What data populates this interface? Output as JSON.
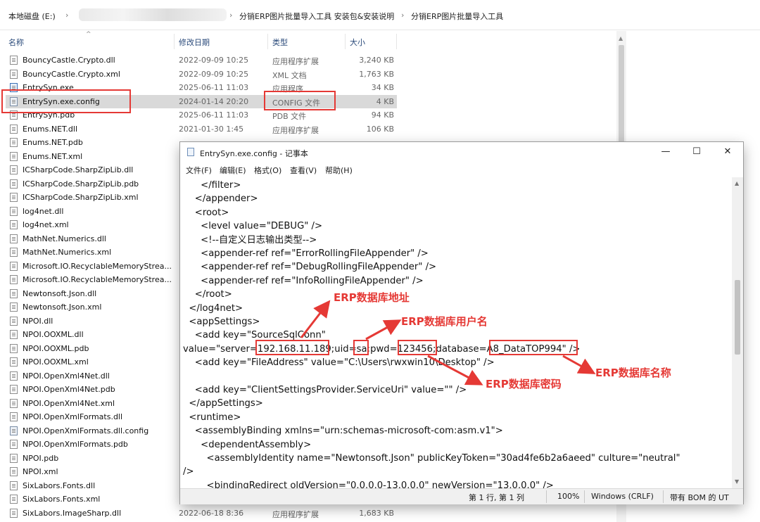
{
  "breadcrumb": {
    "root": "本地磁盘 (E:)",
    "sep": "›",
    "folder1": "分销ERP图片批量导入工具 安装包&安装说明",
    "folder2": "分销ERP图片批量导入工具"
  },
  "columns": {
    "name": "名称",
    "date": "修改日期",
    "type": "类型",
    "size": "大小"
  },
  "files": [
    {
      "name": "BouncyCastle.Crypto.dll",
      "date": "2022-09-09 10:25",
      "type": "应用程序扩展",
      "size": "3,240 KB",
      "icon": "dll-file-icon"
    },
    {
      "name": "BouncyCastle.Crypto.xml",
      "date": "2022-09-09 10:25",
      "type": "XML 文档",
      "size": "1,763 KB",
      "icon": "xml-file-icon"
    },
    {
      "name": "EntrySyn.exe",
      "date": "2025-06-11 11:03",
      "type": "应用程序",
      "size": "34 KB",
      "icon": "exe-file-icon"
    },
    {
      "name": "EntrySyn.exe.config",
      "date": "2024-01-14 20:20",
      "type": "CONFIG 文件",
      "size": "4 KB",
      "icon": "config-file-icon",
      "selected": true
    },
    {
      "name": "EntrySyn.pdb",
      "date": "2025-06-11 11:03",
      "type": "PDB 文件",
      "size": "94 KB",
      "icon": "pdb-file-icon"
    },
    {
      "name": "Enums.NET.dll",
      "date": "2021-01-30 1:45",
      "type": "应用程序扩展",
      "size": "106 KB",
      "icon": "dll-file-icon"
    },
    {
      "name": "Enums.NET.pdb",
      "date": "",
      "type": "",
      "size": "",
      "icon": "pdb-file-icon"
    },
    {
      "name": "Enums.NET.xml",
      "date": "",
      "type": "",
      "size": "",
      "icon": "xml-file-icon"
    },
    {
      "name": "ICSharpCode.SharpZipLib.dll",
      "date": "",
      "type": "",
      "size": "",
      "icon": "dll-file-icon"
    },
    {
      "name": "ICSharpCode.SharpZipLib.pdb",
      "date": "",
      "type": "",
      "size": "",
      "icon": "pdb-file-icon"
    },
    {
      "name": "ICSharpCode.SharpZipLib.xml",
      "date": "",
      "type": "",
      "size": "",
      "icon": "xml-file-icon"
    },
    {
      "name": "log4net.dll",
      "date": "",
      "type": "",
      "size": "",
      "icon": "dll-file-icon"
    },
    {
      "name": "log4net.xml",
      "date": "",
      "type": "",
      "size": "",
      "icon": "xml-file-icon"
    },
    {
      "name": "MathNet.Numerics.dll",
      "date": "",
      "type": "",
      "size": "",
      "icon": "dll-file-icon"
    },
    {
      "name": "MathNet.Numerics.xml",
      "date": "",
      "type": "",
      "size": "",
      "icon": "xml-file-icon"
    },
    {
      "name": "Microsoft.IO.RecyclableMemoryStrea...",
      "date": "",
      "type": "",
      "size": "",
      "icon": "dll-file-icon"
    },
    {
      "name": "Microsoft.IO.RecyclableMemoryStrea...",
      "date": "",
      "type": "",
      "size": "",
      "icon": "xml-file-icon"
    },
    {
      "name": "Newtonsoft.Json.dll",
      "date": "",
      "type": "",
      "size": "",
      "icon": "dll-file-icon"
    },
    {
      "name": "Newtonsoft.Json.xml",
      "date": "",
      "type": "",
      "size": "",
      "icon": "xml-file-icon"
    },
    {
      "name": "NPOI.dll",
      "date": "",
      "type": "",
      "size": "",
      "icon": "dll-file-icon"
    },
    {
      "name": "NPOI.OOXML.dll",
      "date": "",
      "type": "",
      "size": "",
      "icon": "dll-file-icon"
    },
    {
      "name": "NPOI.OOXML.pdb",
      "date": "",
      "type": "",
      "size": "",
      "icon": "pdb-file-icon"
    },
    {
      "name": "NPOI.OOXML.xml",
      "date": "",
      "type": "",
      "size": "",
      "icon": "xml-file-icon"
    },
    {
      "name": "NPOI.OpenXml4Net.dll",
      "date": "",
      "type": "",
      "size": "",
      "icon": "dll-file-icon"
    },
    {
      "name": "NPOI.OpenXml4Net.pdb",
      "date": "",
      "type": "",
      "size": "",
      "icon": "pdb-file-icon"
    },
    {
      "name": "NPOI.OpenXml4Net.xml",
      "date": "",
      "type": "",
      "size": "",
      "icon": "xml-file-icon"
    },
    {
      "name": "NPOI.OpenXmlFormats.dll",
      "date": "",
      "type": "",
      "size": "",
      "icon": "dll-file-icon"
    },
    {
      "name": "NPOI.OpenXmlFormats.dll.config",
      "date": "",
      "type": "",
      "size": "",
      "icon": "config-file-icon"
    },
    {
      "name": "NPOI.OpenXmlFormats.pdb",
      "date": "",
      "type": "",
      "size": "",
      "icon": "pdb-file-icon"
    },
    {
      "name": "NPOI.pdb",
      "date": "",
      "type": "",
      "size": "",
      "icon": "pdb-file-icon"
    },
    {
      "name": "NPOI.xml",
      "date": "",
      "type": "",
      "size": "",
      "icon": "xml-file-icon"
    },
    {
      "name": "SixLabors.Fonts.dll",
      "date": "",
      "type": "",
      "size": "",
      "icon": "dll-file-icon"
    },
    {
      "name": "SixLabors.Fonts.xml",
      "date": "",
      "type": "",
      "size": "",
      "icon": "xml-file-icon"
    },
    {
      "name": "SixLabors.ImageSharp.dll",
      "date": "2022-06-18 8:36",
      "type": "应用程序扩展",
      "size": "1,683 KB",
      "icon": "dll-file-icon"
    }
  ],
  "notepad": {
    "title": "EntrySyn.exe.config - 记事本",
    "window_buttons": {
      "minimize": "—",
      "maximize": "☐",
      "close": "✕"
    },
    "menu": [
      "文件(F)",
      "编辑(E)",
      "格式(O)",
      "查看(V)",
      "帮助(H)"
    ],
    "lines": [
      "      </filter>",
      "    </appender>",
      "    <root>",
      "      <level value=\"DEBUG\" />",
      "      <!--自定义日志输出类型-->",
      "      <appender-ref ref=\"ErrorRollingFileAppender\" />",
      "      <appender-ref ref=\"DebugRollingFileAppender\" />",
      "      <appender-ref ref=\"InfoRollingFileAppender\" />",
      "    </root>",
      "  </log4net>",
      "  <appSettings>",
      "    <add key=\"SourceSqlConn\"",
      "value=\"server=192.168.11.189;uid=sa;pwd=123456;database=A8_DataTOP994\" />",
      "    <add key=\"FileAddress\" value=\"C:\\Users\\rwxwin10\\Desktop\" />",
      "",
      "    <add key=\"ClientSettingsProvider.ServiceUri\" value=\"\" />",
      "  </appSettings>",
      "  <runtime>",
      "    <assemblyBinding xmlns=\"urn:schemas-microsoft-com:asm.v1\">",
      "      <dependentAssembly>",
      "        <assemblyIdentity name=\"Newtonsoft.Json\" publicKeyToken=\"30ad4fe6b2a6aeed\" culture=\"neutral\"",
      "/>",
      "        <bindingRedirect oldVersion=\"0.0.0.0-13.0.0.0\" newVersion=\"13.0.0.0\" />"
    ],
    "status": {
      "position": "第 1 行, 第 1 列",
      "zoom": "100%",
      "eol": "Windows (CRLF)",
      "encoding": "带有 BOM 的 UT"
    }
  },
  "annotations": {
    "db_address": "ERP数据库地址",
    "db_user": "ERP数据库用户名",
    "db_password": "ERP数据库密码",
    "db_name": "ERP数据库名称"
  },
  "colors": {
    "highlight": "#e53935",
    "selected_row": "#d9d9d9"
  }
}
